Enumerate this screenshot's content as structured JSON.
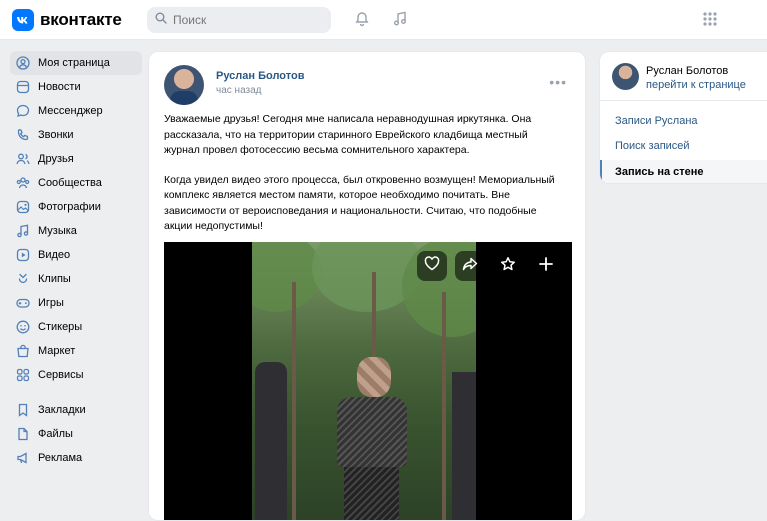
{
  "header": {
    "logo_text": "вконтакте",
    "search_placeholder": "Поиск",
    "icons": [
      "bell-icon",
      "music-icon",
      "apps-grid-icon"
    ]
  },
  "sidebar": {
    "items": [
      {
        "label": "Моя страница",
        "icon": "user-circle-icon",
        "active": true
      },
      {
        "label": "Новости",
        "icon": "news-icon"
      },
      {
        "label": "Мессенджер",
        "icon": "chat-icon"
      },
      {
        "label": "Звонки",
        "icon": "phone-icon"
      },
      {
        "label": "Друзья",
        "icon": "friends-icon"
      },
      {
        "label": "Сообщества",
        "icon": "communities-icon"
      },
      {
        "label": "Фотографии",
        "icon": "photo-icon"
      },
      {
        "label": "Музыка",
        "icon": "music-icon"
      },
      {
        "label": "Видео",
        "icon": "video-icon"
      },
      {
        "label": "Клипы",
        "icon": "clips-icon"
      },
      {
        "label": "Игры",
        "icon": "games-icon"
      },
      {
        "label": "Стикеры",
        "icon": "stickers-icon"
      },
      {
        "label": "Маркет",
        "icon": "market-icon"
      },
      {
        "label": "Сервисы",
        "icon": "services-icon"
      }
    ],
    "items2": [
      {
        "label": "Закладки",
        "icon": "bookmark-icon"
      },
      {
        "label": "Файлы",
        "icon": "file-icon"
      },
      {
        "label": "Реклама",
        "icon": "ads-icon"
      }
    ]
  },
  "post": {
    "author": "Руслан Болотов",
    "time": "час назад",
    "paragraph1": "Уважаемые друзья! Сегодня мне написала неравнодушная иркутянка. Она рассказала, что на территории старинного Еврейского кладбища местный журнал провел фотосессию весьма сомнительного характера.",
    "paragraph2": "Когда увидел видео этого процесса, был откровенно возмущен! Мемориальный комплекс является местом памяти, которое необходимо почитать. Вне зависимости от вероисповедания и национальности. Считаю, что подобные акции недопустимы!",
    "photo_actions": [
      "heart-icon",
      "share-icon",
      "star-icon",
      "plus-icon"
    ]
  },
  "right_panel": {
    "name": "Руслан Болотов",
    "link": "перейти к странице",
    "items": [
      {
        "label": "Записи Руслана"
      },
      {
        "label": "Поиск записей"
      },
      {
        "label": "Запись на стене",
        "active": true
      }
    ]
  },
  "colors": {
    "accent": "#0077ff",
    "link": "#2a5885",
    "background": "#edeef0"
  }
}
